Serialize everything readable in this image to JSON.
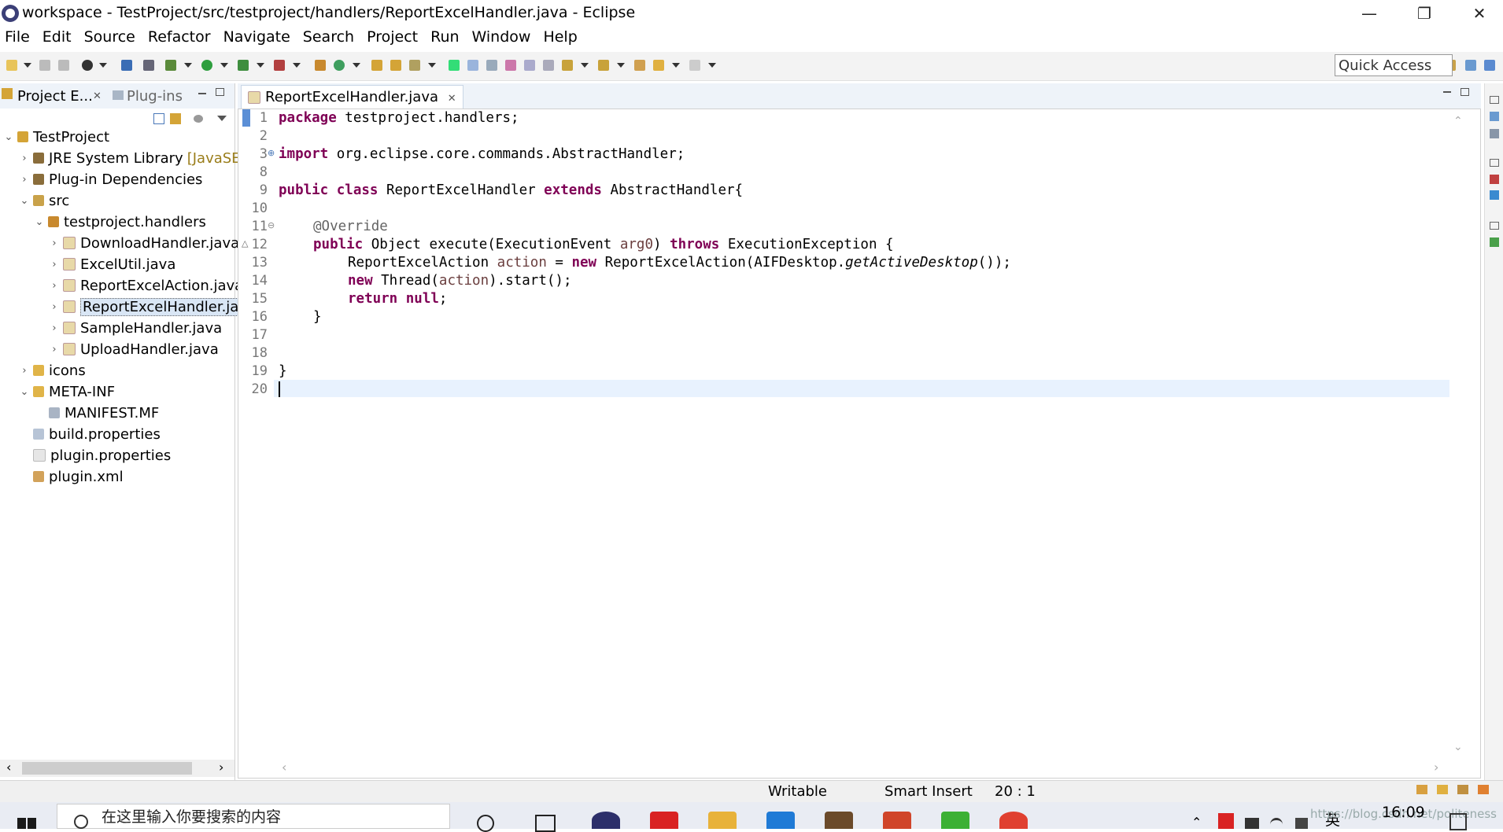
{
  "window": {
    "title": "workspace - TestProject/src/testproject/handlers/ReportExcelHandler.java - Eclipse",
    "minimize": "—",
    "restore": "❐",
    "close": "✕"
  },
  "menu": [
    "File",
    "Edit",
    "Source",
    "Refactor",
    "Navigate",
    "Search",
    "Project",
    "Run",
    "Window",
    "Help"
  ],
  "toolbar": {
    "quick_access": "Quick Access"
  },
  "left_panel": {
    "tabs": [
      {
        "label": "Project E...",
        "close": "✕"
      },
      {
        "label": "Plug-ins"
      }
    ],
    "tree": [
      {
        "label": "TestProject",
        "expanded": true,
        "icon": "project-icon"
      },
      {
        "label": "JRE System Library",
        "suffix": "[JavaSE-",
        "expanded": false,
        "icon": "library-icon"
      },
      {
        "label": "Plug-in Dependencies",
        "expanded": false,
        "icon": "library-icon"
      },
      {
        "label": "src",
        "expanded": true,
        "icon": "source-folder-icon"
      },
      {
        "label": "testproject.handlers",
        "expanded": true,
        "icon": "package-icon"
      },
      {
        "label": "DownloadHandler.java",
        "expanded": false,
        "icon": "java-file-icon"
      },
      {
        "label": "ExcelUtil.java",
        "expanded": false,
        "icon": "java-file-icon"
      },
      {
        "label": "ReportExcelAction.java",
        "expanded": false,
        "icon": "java-file-icon"
      },
      {
        "label": "ReportExcelHandler.jav",
        "expanded": false,
        "icon": "java-file-icon",
        "selected": true
      },
      {
        "label": "SampleHandler.java",
        "expanded": false,
        "icon": "java-file-icon"
      },
      {
        "label": "UploadHandler.java",
        "expanded": false,
        "icon": "java-file-icon"
      },
      {
        "label": "icons",
        "expanded": false,
        "icon": "folder-icon"
      },
      {
        "label": "META-INF",
        "expanded": true,
        "icon": "folder-icon"
      },
      {
        "label": "MANIFEST.MF",
        "icon": "manifest-icon"
      },
      {
        "label": "build.properties",
        "icon": "properties-icon"
      },
      {
        "label": "plugin.properties",
        "icon": "file-icon"
      },
      {
        "label": "plugin.xml",
        "icon": "xml-icon"
      }
    ]
  },
  "editor": {
    "tab_label": "ReportExcelHandler.java",
    "tab_close": "✕",
    "line_numbers": [
      "1",
      "2",
      "3",
      "8",
      "9",
      "10",
      "11",
      "12",
      "13",
      "14",
      "15",
      "16",
      "17",
      "18",
      "19",
      "20"
    ],
    "lines": {
      "l1_kw": "package",
      "l1_rest": " testproject.handlers;",
      "l3_kw": "import",
      "l3_rest": " org.eclipse.core.commands.AbstractHandler;",
      "l9_kw1": "public",
      "l9_kw2": "class",
      "l9_mid": " ReportExcelHandler ",
      "l9_kw3": "extends",
      "l9_rest": " AbstractHandler{",
      "l11_ann": "@Override",
      "l12_kw1": "public",
      "l12_mid": " Object execute(ExecutionEvent ",
      "l12_var": "arg0",
      "l12_mid2": ") ",
      "l12_kw2": "throws",
      "l12_rest": " ExecutionException {",
      "l13_a": "ReportExcelAction ",
      "l13_var": "action",
      "l13_b": " = ",
      "l13_kw": "new",
      "l13_c": " ReportExcelAction(AIFDesktop.",
      "l13_it": "getActiveDesktop",
      "l13_d": "());",
      "l14_kw": "new",
      "l14_a": " Thread(",
      "l14_var": "action",
      "l14_b": ").start();",
      "l15_kw1": "return",
      "l15_sp": " ",
      "l15_kw2": "null",
      "l15_end": ";",
      "l16": "}",
      "l19": "}"
    }
  },
  "status": {
    "writable": "Writable",
    "insert_mode": "Smart Insert",
    "position": "20 : 1"
  },
  "taskbar": {
    "search_placeholder": "在这里输入你要搜索的内容",
    "clock": "16:09",
    "watermark": "https://blog.csdn.net/politeness",
    "lang": "英"
  }
}
